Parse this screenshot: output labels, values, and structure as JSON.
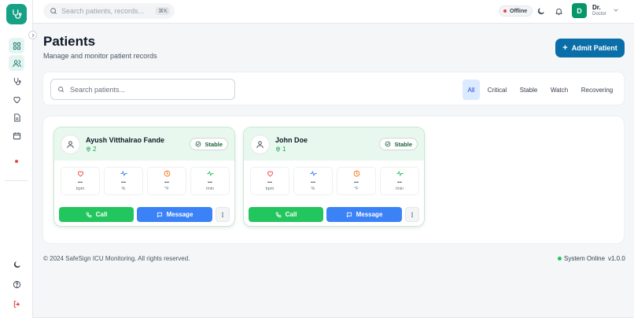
{
  "topbar": {
    "search_placeholder": "Search patients, records...",
    "search_shortcut": "⌘K",
    "connection_status": "Offline",
    "user_initial": "D",
    "user_name": "Dr.",
    "user_role": "Doctor"
  },
  "sidebar": {
    "items": [
      "dashboard",
      "patients",
      "stethoscope",
      "heart",
      "records",
      "calendar",
      "alert"
    ],
    "bottom": [
      "theme",
      "help",
      "logout"
    ]
  },
  "header": {
    "title": "Patients",
    "subtitle": "Manage and monitor patient records",
    "admit_label": "Admit Patient"
  },
  "filters": {
    "search_placeholder": "Search patients...",
    "tabs": [
      "All",
      "Critical",
      "Stable",
      "Watch",
      "Recovering"
    ],
    "active": "All"
  },
  "patients": [
    {
      "name": "Ayush Vitthalrao Fande",
      "bed": "2",
      "status": "Stable",
      "vitals": [
        {
          "value": "--",
          "unit": "bpm"
        },
        {
          "value": "--",
          "unit": "%"
        },
        {
          "value": "--",
          "unit": "°F"
        },
        {
          "value": "--",
          "unit": "/min"
        }
      ],
      "call_label": "Call",
      "message_label": "Message"
    },
    {
      "name": "John Doe",
      "bed": "1",
      "status": "Stable",
      "vitals": [
        {
          "value": "--",
          "unit": "bpm"
        },
        {
          "value": "--",
          "unit": "%"
        },
        {
          "value": "--",
          "unit": "°F"
        },
        {
          "value": "--",
          "unit": "/min"
        }
      ],
      "call_label": "Call",
      "message_label": "Message"
    }
  ],
  "footer": {
    "copyright": "© 2024 SafeSign ICU Monitoring. All rights reserved.",
    "system_status": "System Online",
    "version": "v1.0.0"
  },
  "colors": {
    "brand": "#16a085",
    "primary_button": "#0a6ea8",
    "call": "#22c55e",
    "message": "#3b82f6",
    "stable": "#166534",
    "offline": "#ef4444",
    "online": "#22c55e"
  }
}
